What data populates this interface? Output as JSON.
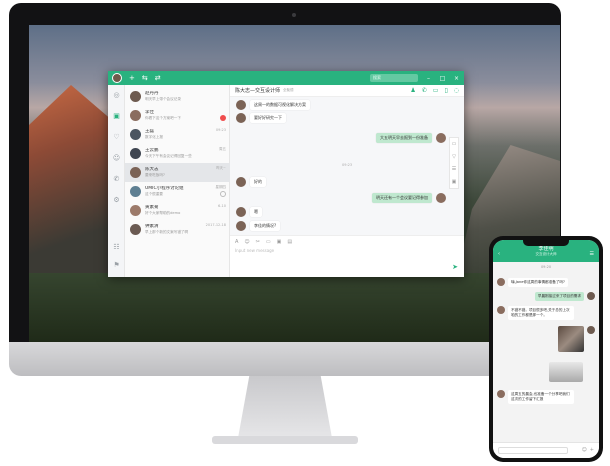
{
  "app": {
    "search_placeholder": "搜索",
    "topbar_icons": [
      "+",
      "⇆",
      "⇄"
    ],
    "window_controls": [
      "–",
      "□",
      "×"
    ],
    "rail_icons": [
      "◎",
      "▣",
      "♡",
      "☺",
      "✆",
      "⚙",
      "☷",
      "⚑"
    ],
    "list": [
      {
        "name": "赵丹丹",
        "msg": "明天早上带个会议记录",
        "time": "",
        "avatar": "#6e5b50"
      },
      {
        "name": "李佳",
        "msg": "你看下这个方案吧一下",
        "time": "",
        "badge": "",
        "avatar": "#8a6d5f"
      },
      {
        "name": "王磊",
        "msg": "数字化上报",
        "time": "09:23",
        "avatar": "#4b5560"
      },
      {
        "name": "王云鹏",
        "msg": "今天下午有会议记得回复一些",
        "time": "周五",
        "avatar": "#3f4651"
      },
      {
        "name": "陈大志",
        "msg": "要来吃饭吗?",
        "time": "昨天~",
        "avatar": "#7b6356",
        "selected": true
      },
      {
        "name": "UMIC小程序讨论组",
        "msg": "这个很重要",
        "time": "星期四",
        "avatar": "#5e7f92"
      },
      {
        "name": "黄素菊",
        "msg": "好个大家帮助的demo",
        "time": "6-10",
        "avatar": "#9c7a6a"
      },
      {
        "name": "钟素清",
        "msg": "早上那个新的文案写错了啊",
        "time": "2017-12-18",
        "avatar": "#6a5a52"
      }
    ],
    "chat": {
      "title": "陈大志—交互设计师",
      "subtitle": "全聚德",
      "header_icons": [
        "♟",
        "✆",
        "▭",
        "▯",
        "◌"
      ],
      "messages": [
        {
          "text": "这周一的数据可视化解决方案",
          "me": false
        },
        {
          "text": "要好好研究一下",
          "me": false
        },
        {
          "text": "大五明天早去报到一份准备",
          "me": true
        },
        {
          "text": "好的",
          "me": false
        },
        {
          "text": "明天还有一个会议要记得参加",
          "me": true
        },
        {
          "text": "嗯",
          "me": false
        },
        {
          "text": "李佳的情况?",
          "me": false
        }
      ],
      "timestamp": "09:23",
      "side_tools": [
        "▭",
        "▽",
        "☰",
        "▣"
      ],
      "composer_tools": [
        "A",
        "☺",
        "✂",
        "▭",
        "▣",
        "▤"
      ],
      "placeholder": "Input new message",
      "send_icon": "➤"
    }
  },
  "phone": {
    "title": "李佳明",
    "subtitle": "交互设计大师",
    "back_icon": "‹",
    "menu_icon": "☰",
    "timestamp": "09:20",
    "messages": [
      {
        "text": "嗨,Jane你这周的事情都准备了吗?",
        "me": false
      },
      {
        "text": "早晨刚接过来了项目的需求",
        "me": true
      },
      {
        "text": "不错不错。项目很多吧,关于总的上次咱的工作都是那一个。",
        "me": false
      },
      {
        "text": "",
        "me": true,
        "image": true
      },
      {
        "text": "",
        "me": false,
        "image2": true
      },
      {
        "text": "这周五的晨会,也准备一个分享吧我们这次的工作留下汇报",
        "me": false
      }
    ],
    "input_icons": [
      "☺",
      "+"
    ]
  }
}
